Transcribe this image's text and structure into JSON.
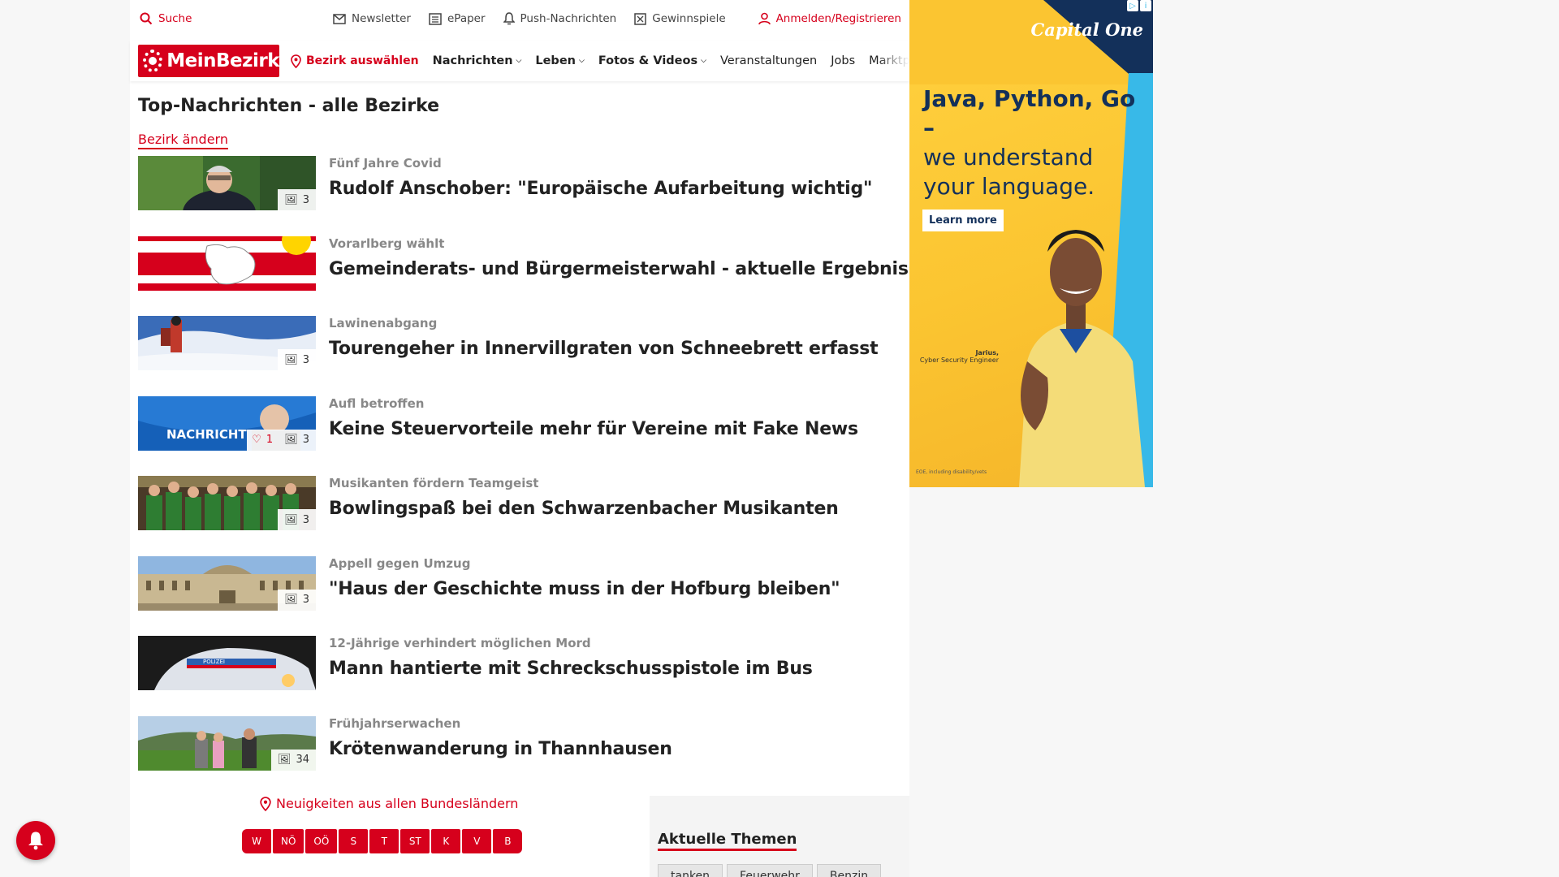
{
  "utility": {
    "search": "Suche",
    "newsletter": "Newsletter",
    "epaper": "ePaper",
    "push": "Push-Nachrichten",
    "gewinnspiele": "Gewinnspiele",
    "login": "Anmelden/Registrieren"
  },
  "nav": {
    "logo": "MeinBezirk",
    "bezirk": "Bezirk auswählen",
    "items": [
      {
        "label": "Nachrichten",
        "dropdown": true
      },
      {
        "label": "Leben",
        "dropdown": true
      },
      {
        "label": "Fotos & Videos",
        "dropdown": true
      },
      {
        "label": "Veranstaltungen",
        "dropdown": false
      },
      {
        "label": "Jobs",
        "dropdown": false
      },
      {
        "label": "Marktplatz",
        "dropdown": false
      }
    ]
  },
  "main": {
    "title": "Top-Nachrichten - alle Bezirke",
    "change_link": "Bezirk ändern",
    "articles": [
      {
        "kicker": "Fünf Jahre Covid",
        "headline": "Rudolf Anschober: \"Europäische Aufarbeitung wichtig\"",
        "photos": "3",
        "likes": "",
        "thumb": "portrait"
      },
      {
        "kicker": "Vorarlberg wählt",
        "headline": "Gemeinderats- und Bürgermeisterwahl - aktuelle Ergebnisse",
        "photos": "",
        "likes": "",
        "thumb": "flag"
      },
      {
        "kicker": "Lawinenabgang",
        "headline": "Tourengeher in Innervillgraten von Schneebrett erfasst",
        "photos": "3",
        "likes": "",
        "thumb": "snow"
      },
      {
        "kicker": "Aufl betroffen",
        "headline": "Keine Steuervorteile mehr für Vereine mit Fake News",
        "photos": "3",
        "likes": "1",
        "thumb": "news"
      },
      {
        "kicker": "Musikanten fördern Teamgeist",
        "headline": "Bowlingspaß bei den Schwarzenbacher Musikanten",
        "photos": "3",
        "likes": "",
        "thumb": "group"
      },
      {
        "kicker": "Appell gegen Umzug",
        "headline": "\"Haus der Geschichte muss in der Hofburg bleiben\"",
        "photos": "3",
        "likes": "",
        "thumb": "building"
      },
      {
        "kicker": "12-Jährige verhindert möglichen Mord",
        "headline": "Mann hantierte mit Schreckschusspistole im Bus",
        "photos": "",
        "likes": "",
        "thumb": "police"
      },
      {
        "kicker": "Frühjahrserwachen",
        "headline": "Krötenwanderung in Thannhausen",
        "photos": "34",
        "likes": "",
        "thumb": "field"
      }
    ]
  },
  "bundeslaender": {
    "link": "Neuigkeiten aus allen Bundesländern",
    "buttons": [
      "W",
      "NÖ",
      "OÖ",
      "S",
      "T",
      "ST",
      "K",
      "V",
      "B"
    ]
  },
  "themes": {
    "title": "Aktuelle Themen",
    "tags": [
      "tanken",
      "Feuerwehr",
      "Benzin"
    ]
  },
  "ad": {
    "brand": "Capital One",
    "headline_bold": "Java, Python, Go –",
    "headline_rest": "we understand your language.",
    "button": "Learn more",
    "caption_name": "Jarius,",
    "caption_role": "Cyber Security Engineer",
    "fine_print": "EOE, including disability/vets"
  },
  "colors": {
    "brand_red": "#d6001c",
    "ad_navy": "#13305a",
    "ad_yellow": "#fbc531",
    "ad_cyan": "#38b9e8"
  }
}
